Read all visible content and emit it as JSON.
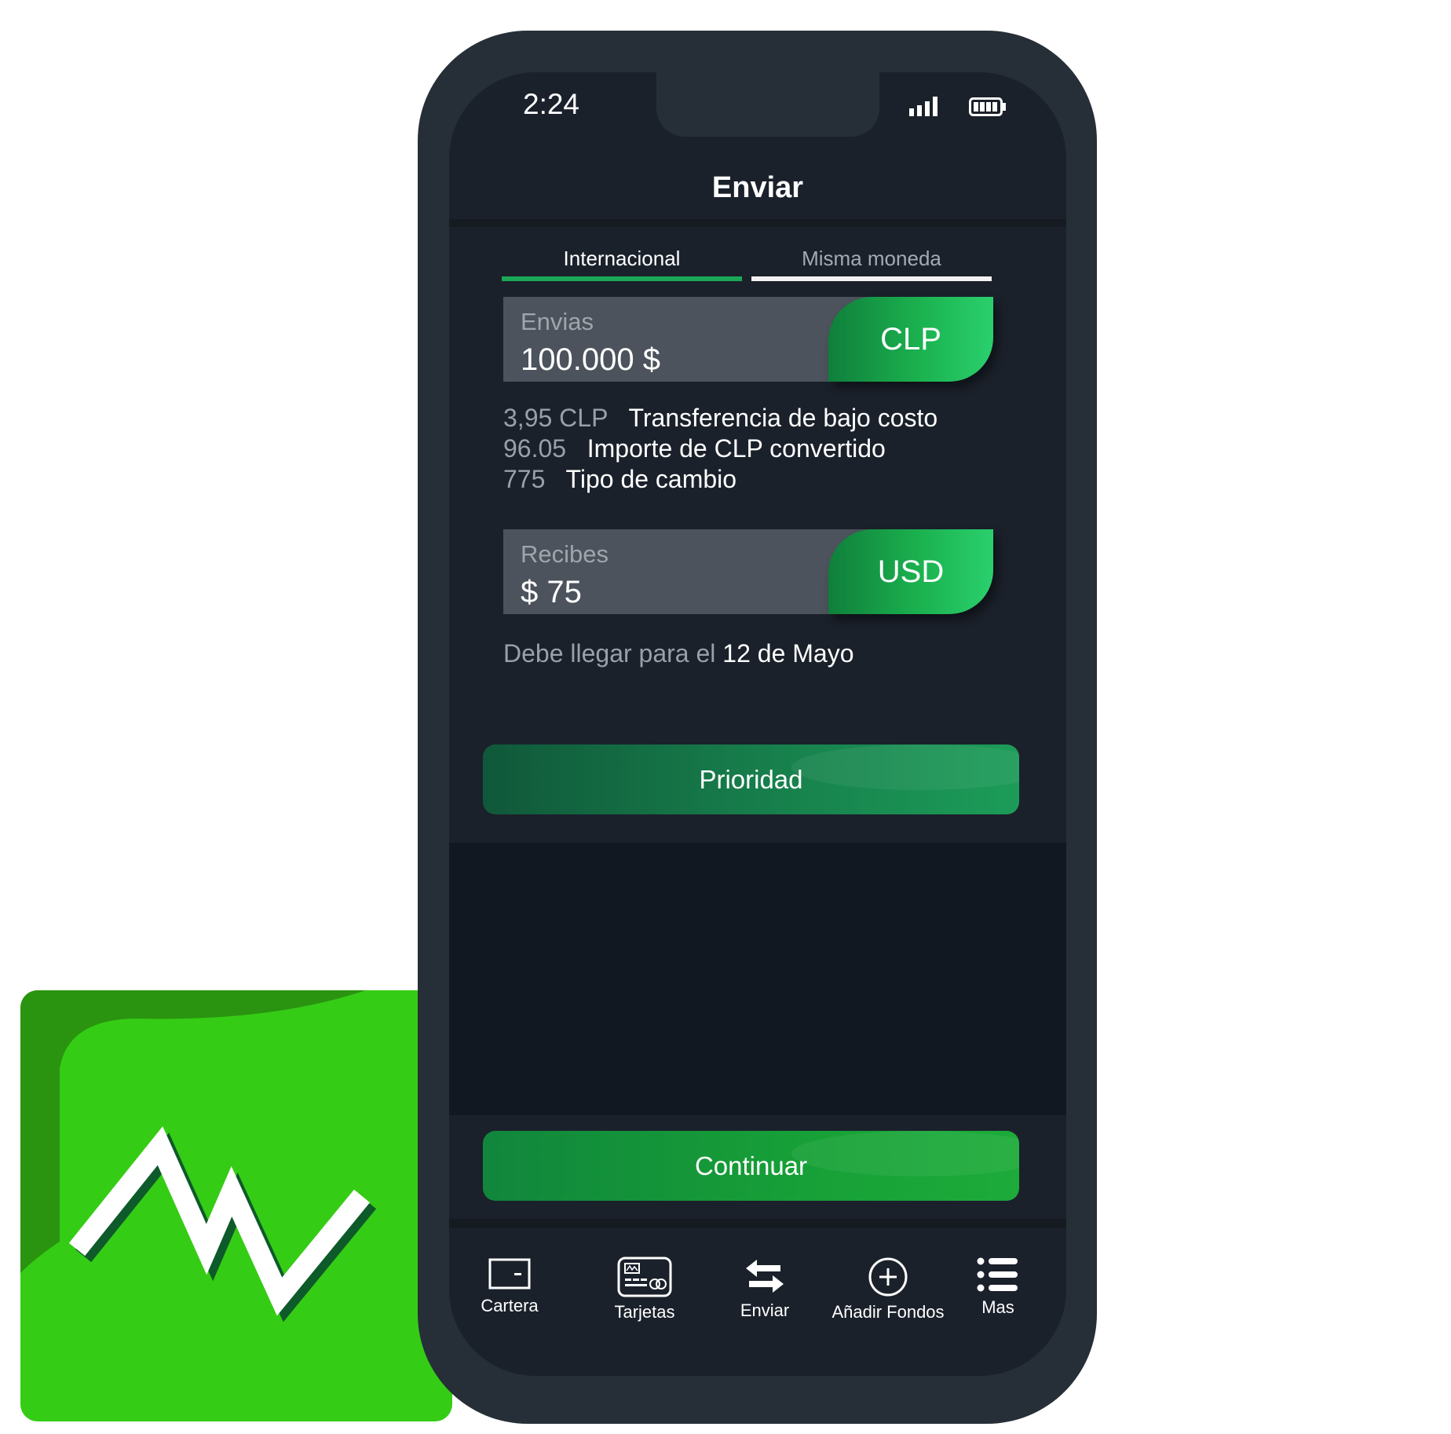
{
  "status_bar": {
    "time": "2:24"
  },
  "header": {
    "title": "Enviar"
  },
  "tabs": [
    {
      "label": "Internacional",
      "active": true
    },
    {
      "label": "Misma moneda",
      "active": false
    }
  ],
  "send": {
    "label": "Envias",
    "value": "100.000 $",
    "currency": "CLP"
  },
  "details": [
    {
      "value": "3,95 CLP",
      "label": "Transferencia de bajo costo"
    },
    {
      "value": "96.05",
      "label": "Importe de CLP convertido"
    },
    {
      "value": "775",
      "label": "Tipo de cambio"
    }
  ],
  "receive": {
    "label": "Recibes",
    "value": "$ 75",
    "currency": "USD"
  },
  "arrival": {
    "prefix": "Debe llegar para el",
    "date": "12 de Mayo"
  },
  "buttons": {
    "priority": "Prioridad",
    "continue": "Continuar"
  },
  "nav": [
    {
      "label": "Cartera",
      "icon": "wallet-icon"
    },
    {
      "label": "Tarjetas",
      "icon": "card-icon"
    },
    {
      "label": "Enviar",
      "icon": "transfer-arrows-icon"
    },
    {
      "label": "Añadir Fondos",
      "icon": "plus-circle-icon"
    },
    {
      "label": "Mas",
      "icon": "menu-list-icon"
    }
  ],
  "colors": {
    "accent": "#1aa956",
    "background": "#1b212b",
    "logo_green": "#35cc15"
  }
}
